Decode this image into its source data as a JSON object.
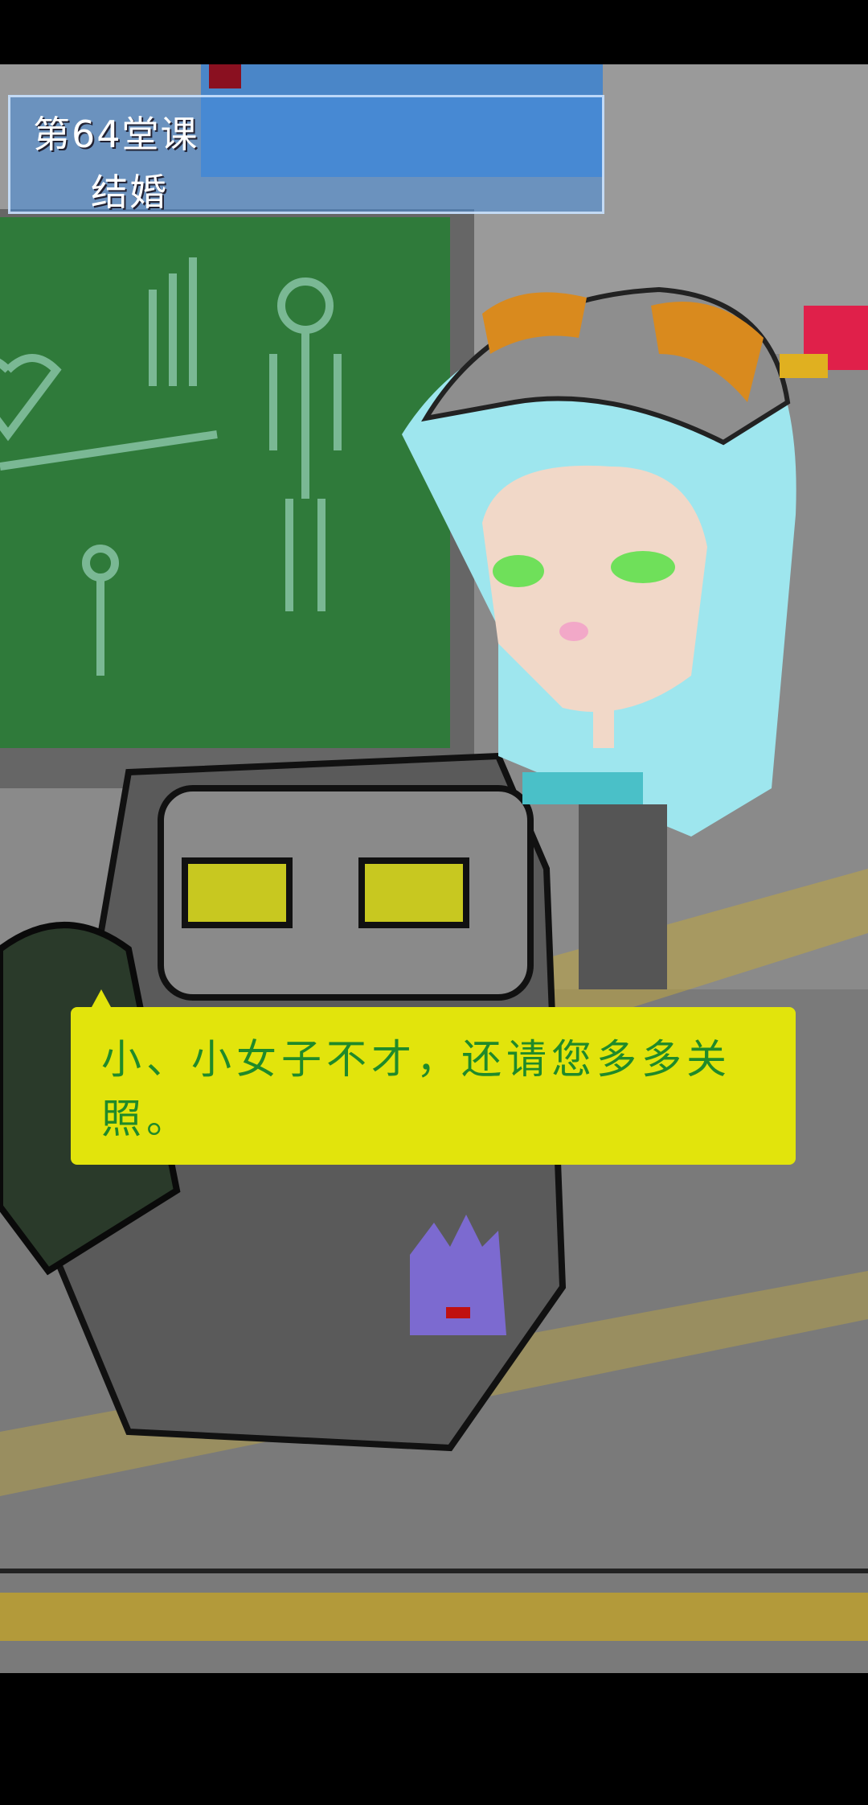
{
  "lesson": {
    "number_label": "第64堂课",
    "title": "结婚"
  },
  "dialog": {
    "text": "小、小女子不才，还请您多多关照。"
  },
  "colors": {
    "dialog_bg": "#e2e40c",
    "dialog_text": "#1f8a2a",
    "lesson_box": "#468cdc",
    "chalkboard": "#2f7a3a"
  }
}
